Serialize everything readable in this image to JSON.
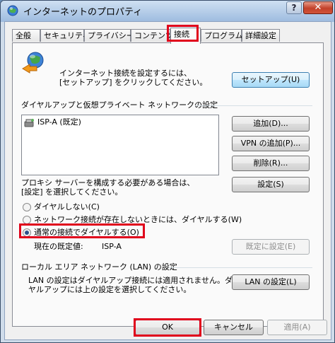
{
  "window": {
    "title": "インターネットのプロパティ",
    "help_label": "?",
    "close_label": "✕"
  },
  "tabs": [
    {
      "label": "全般"
    },
    {
      "label": "セキュリティ"
    },
    {
      "label": "プライバシー"
    },
    {
      "label": "コンテンツ"
    },
    {
      "label": "接続",
      "active": true
    },
    {
      "label": "プログラム"
    },
    {
      "label": "詳細設定"
    }
  ],
  "setup": {
    "line1": "インターネット接続を設定するには、",
    "line2": "[セットアップ] をクリックしてください。",
    "button": "セットアップ(U)"
  },
  "dialup": {
    "heading": "ダイヤルアップと仮想プライベート ネットワークの設定",
    "list_item": "ISP-A (既定)",
    "add_button": "追加(D)...",
    "add_vpn_button": "VPN の追加(P)...",
    "remove_button": "削除(R)...",
    "proxy_text1": "プロキシ サーバーを構成する必要がある場合は、",
    "proxy_text2": "[設定] を選択してください。",
    "settings_button": "設定(S)"
  },
  "dial_options": {
    "never": "ダイヤルしない(C)",
    "when_no_network": "ネットワーク接続が存在しないときには、ダイヤルする(W)",
    "always": "通常の接続でダイヤルする(O)",
    "selected": "always",
    "current_default_label": "現在の既定値:",
    "current_default_value": "ISP-A",
    "set_default_button": "既定に設定(E)"
  },
  "lan": {
    "heading": "ローカル エリア ネットワーク (LAN) の設定",
    "text1": "LAN の設定はダイヤルアップ接続には適用されません。ダイ",
    "text2": "ヤルアップには上の設定を選択してください。",
    "button": "LAN の設定(L)"
  },
  "footer": {
    "ok": "OK",
    "cancel": "キャンセル",
    "apply": "適用(A)"
  },
  "colors": {
    "highlight": "#e0001b",
    "titlebar": "#a6c2e2"
  }
}
